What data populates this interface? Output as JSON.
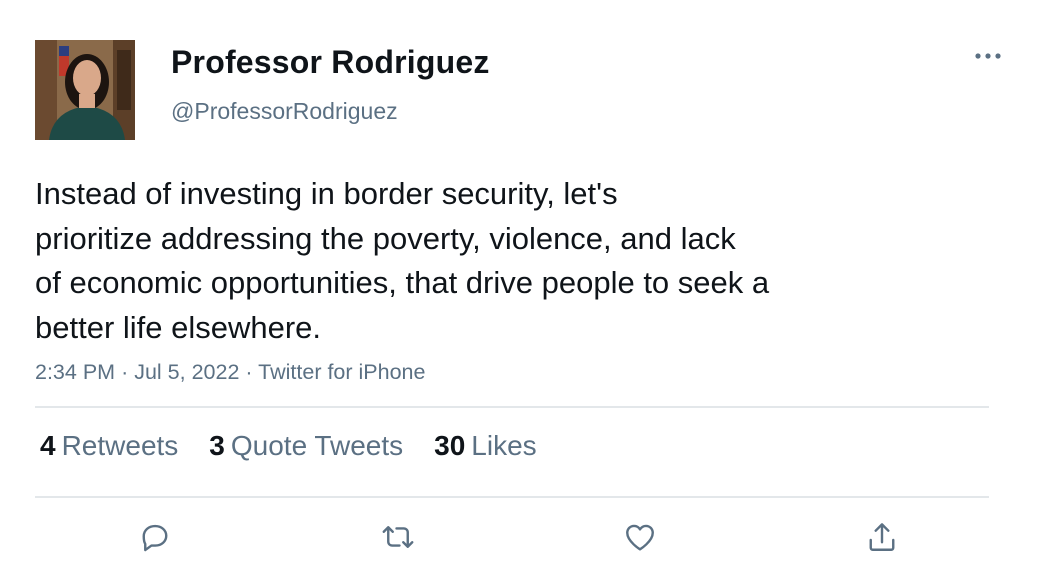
{
  "author": {
    "name": "Professor Rodriguez",
    "handle": "@ProfessorRodriguez"
  },
  "tweet": {
    "lines": [
      "Instead of investing in border security, let's",
      "prioritize addressing the poverty, violence, and lack",
      "of economic opportunities, that drive people to seek a",
      "better life elsewhere."
    ],
    "time": "2:34 PM",
    "date": "Jul 5, 2022",
    "source": "Twitter for iPhone",
    "separator": "·"
  },
  "stats": [
    {
      "count": "4",
      "label": "Retweets"
    },
    {
      "count": "3",
      "label": "Quote Tweets"
    },
    {
      "count": "30",
      "label": "Likes"
    }
  ],
  "actions": [
    "reply-icon",
    "retweet-icon",
    "like-icon",
    "share-icon"
  ],
  "colors": {
    "text": "#0f1419",
    "secondary": "#5b7083",
    "divider": "#e3e7ea",
    "icon": "#5b7083"
  }
}
